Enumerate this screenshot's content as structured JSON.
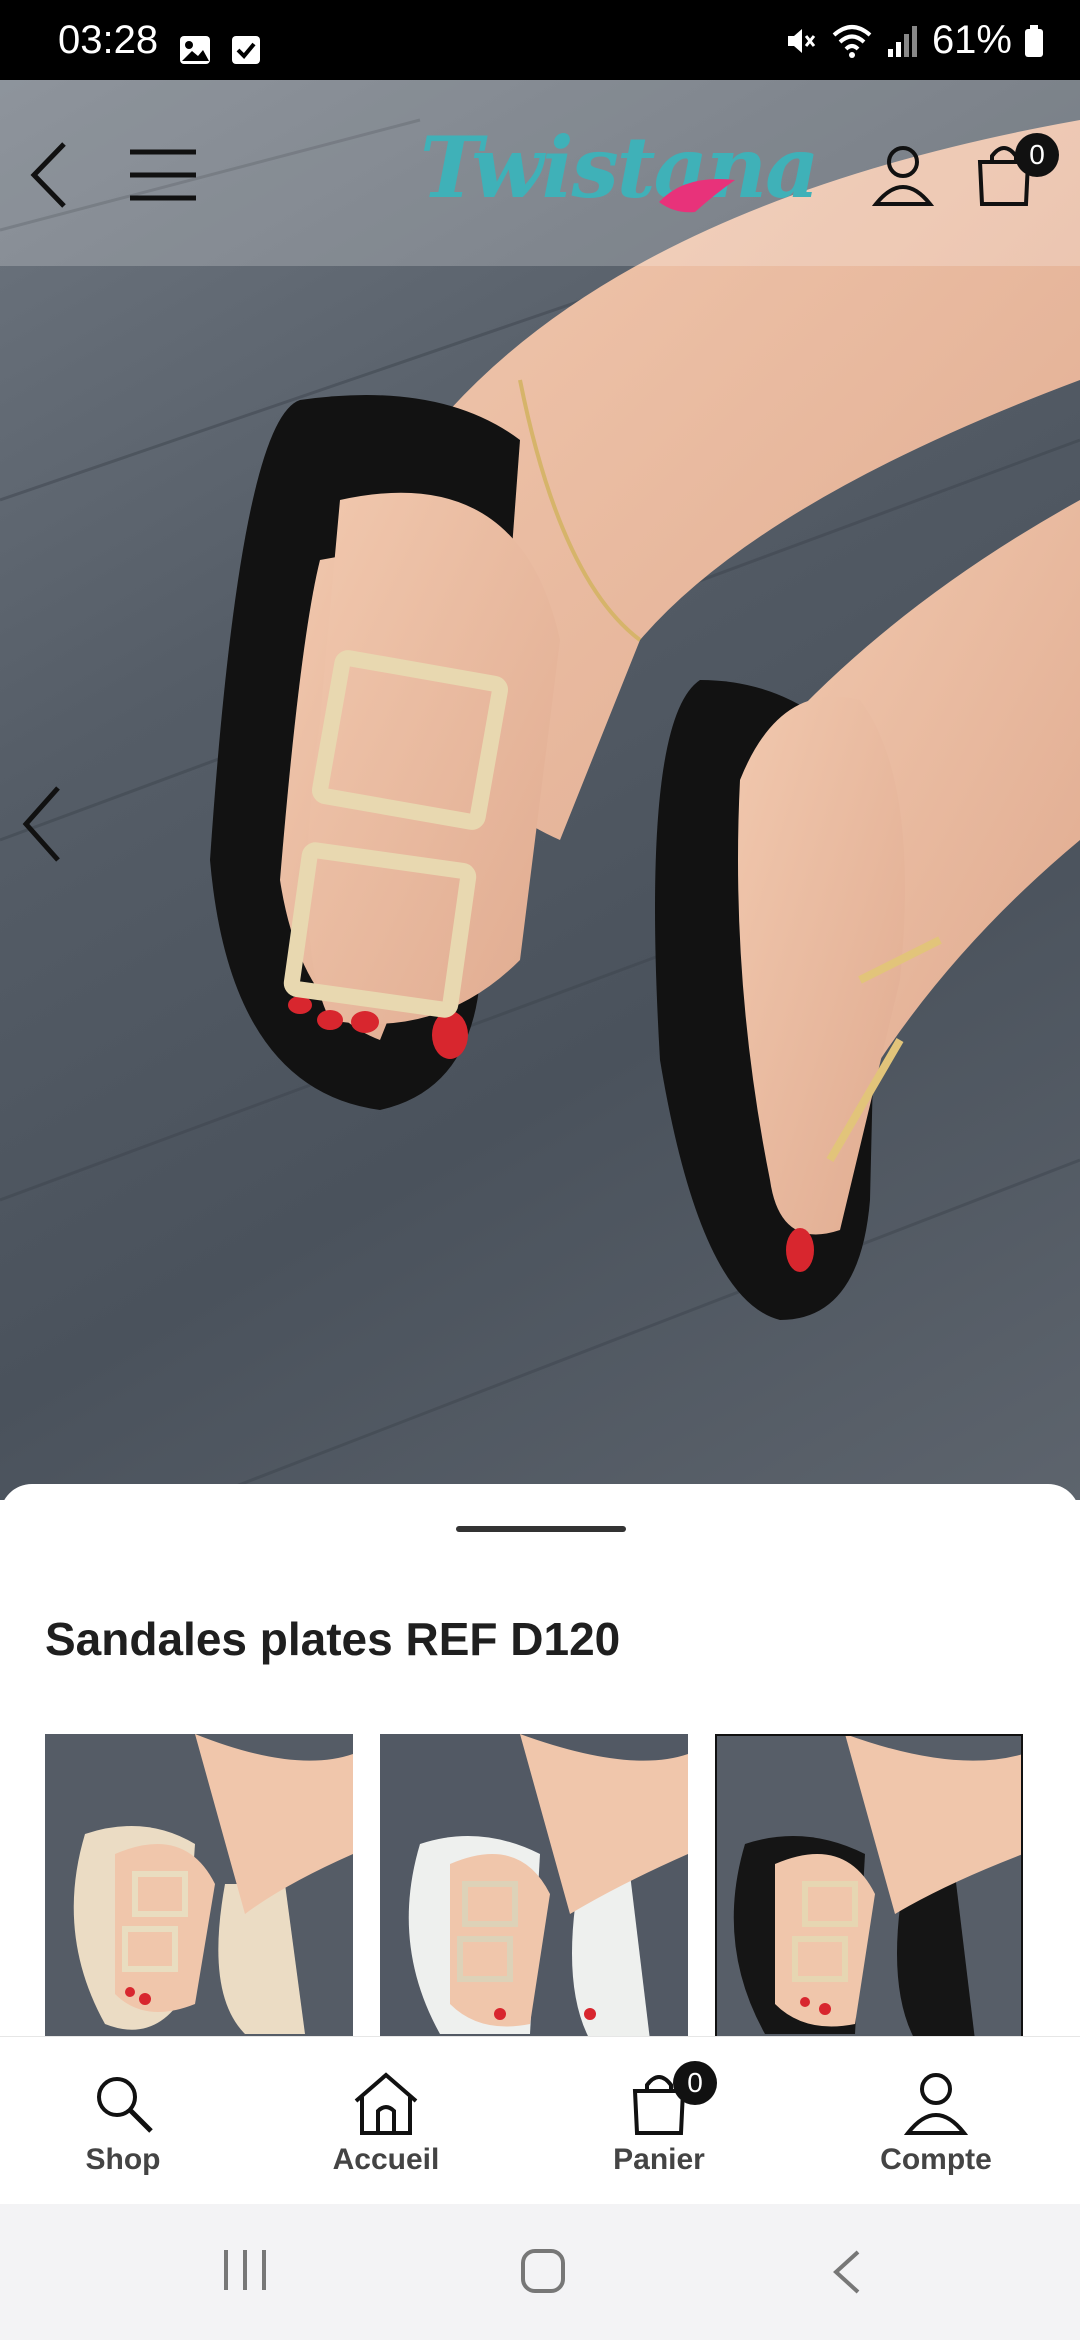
{
  "status_bar": {
    "time": "03:28",
    "battery": "61%",
    "icons": [
      "image-icon",
      "check-box-icon",
      "mute-icon",
      "wifi-icon",
      "signal-icon",
      "battery-icon"
    ]
  },
  "header": {
    "logo": "Twistana",
    "cart_count": "0",
    "icons": [
      "back-arrow-icon",
      "menu-icon",
      "account-icon",
      "cart-icon"
    ]
  },
  "hero": {
    "icons": [
      "previous-image-icon"
    ]
  },
  "product": {
    "title": "Sandales plates REF D120",
    "thumbnails": [
      {
        "variant": "beige",
        "selected": false
      },
      {
        "variant": "white",
        "selected": false
      },
      {
        "variant": "black",
        "selected": true
      }
    ]
  },
  "bottom_nav": {
    "items": [
      {
        "label": "Shop",
        "icon": "search-icon"
      },
      {
        "label": "Accueil",
        "icon": "home-icon"
      },
      {
        "label": "Panier",
        "icon": "cart-icon",
        "badge": "0"
      },
      {
        "label": "Compte",
        "icon": "account-icon"
      }
    ]
  },
  "system_nav": {
    "icons": [
      "recent-apps-icon",
      "home-circle-icon",
      "system-back-icon"
    ]
  },
  "colors": {
    "brand_teal": "#3fb1b8",
    "brand_pink": "#e8327a",
    "status_bar": "#000000",
    "badge": "#111111"
  }
}
